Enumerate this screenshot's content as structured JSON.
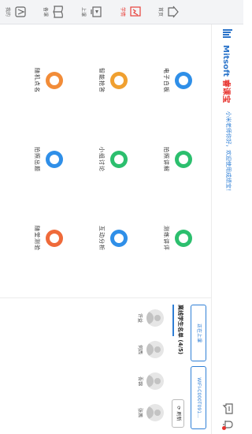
{
  "sidebar": {
    "items": [
      {
        "label": "首页",
        "icon": "home-icon"
      },
      {
        "label": "学情",
        "icon": "study-status-icon",
        "active": true
      },
      {
        "label": "上课",
        "icon": "class-icon"
      },
      {
        "label": "备课",
        "icon": "book-icon"
      },
      {
        "label": "我的",
        "icon": "mine-icon"
      },
      {
        "label": "个人中心",
        "icon": "personal-center-icon"
      }
    ]
  },
  "header": {
    "logo_brand": "Mitsoft",
    "logo_name": "睿课宝",
    "greeting": "小米老师你好，欢迎使用成绩宝！"
  },
  "tools": [
    {
      "label": "电子白板",
      "color": "#2f8fe8"
    },
    {
      "label": "智能抢答",
      "color": "#f0a030"
    },
    {
      "label": "随机点名",
      "color": "#f28c38"
    },
    {
      "label": "拍照讲解",
      "color": "#2cbf6e"
    },
    {
      "label": "小组讨论",
      "color": "#2cbf6e"
    },
    {
      "label": "拍照出题",
      "color": "#2f8fe8"
    },
    {
      "label": "测练讲评",
      "color": "#2cbf6e"
    },
    {
      "label": "互动分析",
      "color": "#2f8fe8"
    },
    {
      "label": "随堂测验",
      "color": "#ef6a3a"
    }
  ],
  "right_panel": {
    "in_class_button": "正在上课",
    "wifi_button": "WIFI-C000T091...",
    "roster_title": "离线学生名单 (4/5)",
    "refresh_label": "刷新",
    "students": [
      "许益",
      "何西",
      "吾锦",
      "张茜"
    ]
  }
}
